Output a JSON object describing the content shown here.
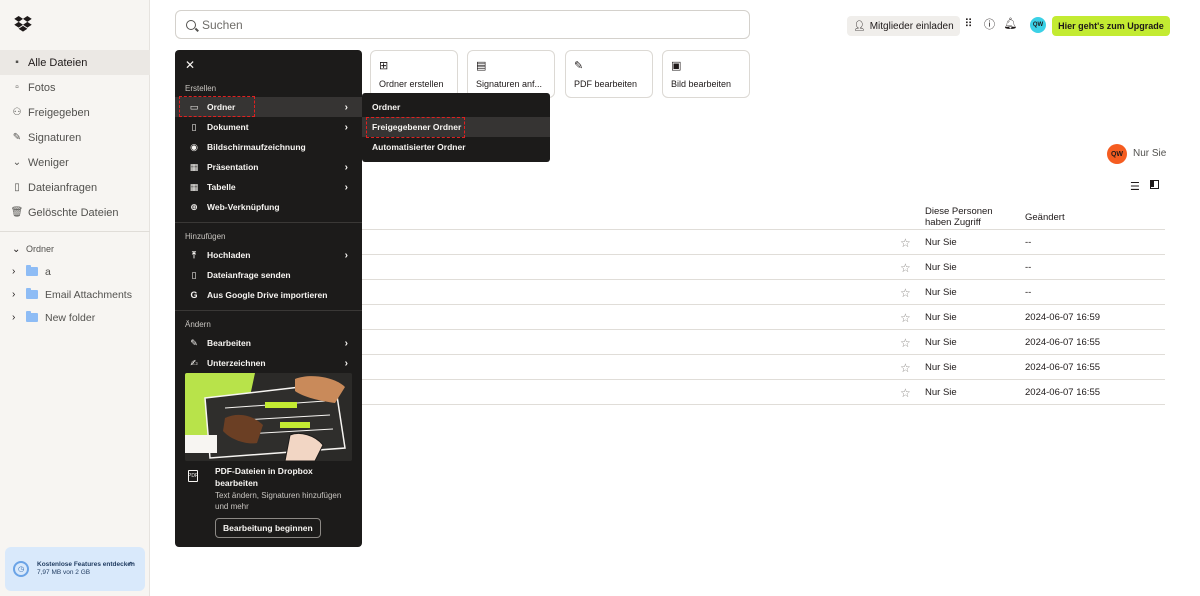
{
  "sidebar": {
    "nav": [
      {
        "label": "Alle Dateien",
        "icon": "files-icon",
        "active": true
      },
      {
        "label": "Fotos",
        "icon": "photo-icon"
      },
      {
        "label": "Freigegeben",
        "icon": "shared-icon"
      },
      {
        "label": "Signaturen",
        "icon": "signature-icon"
      },
      {
        "label": "Weniger",
        "icon": "chevron-down-icon"
      },
      {
        "label": "Dateianfragen",
        "icon": "file-request-icon"
      },
      {
        "label": "Gelöschte Dateien",
        "icon": "trash-icon"
      }
    ],
    "folders_heading": "Ordner",
    "folders": [
      "a",
      "Email Attachments",
      "New folder"
    ],
    "promo": {
      "title": "Kostenlose Features entdecken",
      "usage": "7,97 MB von 2 GB"
    }
  },
  "topbar": {
    "search_placeholder": "Suchen",
    "invite_label": "Mitglieder einladen",
    "avatar_initials": "QW",
    "upgrade_label": "Hier geht's zum Upgrade"
  },
  "quick_actions": [
    {
      "label": "Ordner erstellen",
      "icon": "folder-plus-icon"
    },
    {
      "label": "Signaturen anf...",
      "icon": "signature-request-icon"
    },
    {
      "label": "PDF bearbeiten",
      "icon": "pen-icon"
    },
    {
      "label": "Bild bearbeiten",
      "icon": "image-edit-icon"
    }
  ],
  "table": {
    "owner_initials": "QW",
    "owner_label": "Nur Sie",
    "col_access": "Diese Personen haben Zugriff",
    "col_changed": "Geändert",
    "rows": [
      {
        "access": "Nur Sie",
        "changed": "--"
      },
      {
        "access": "Nur Sie",
        "changed": "--"
      },
      {
        "access": "Nur Sie",
        "changed": "--"
      },
      {
        "access": "Nur Sie",
        "changed": "2024-06-07 16:59"
      },
      {
        "access": "Nur Sie",
        "changed": "2024-06-07 16:55"
      },
      {
        "access": "Nur Sie",
        "changed": "2024-06-07 16:55"
      },
      {
        "access": "Nur Sie",
        "changed": "2024-06-07 16:55"
      }
    ]
  },
  "menu": {
    "section_create": "Erstellen",
    "create_items": [
      "Ordner",
      "Dokument",
      "Bildschirmaufzeichnung",
      "Präsentation",
      "Tabelle",
      "Web-Verknüpfung"
    ],
    "section_add": "Hinzufügen",
    "add_items": [
      "Hochladen",
      "Dateianfrage senden",
      "Aus Google Drive importieren"
    ],
    "section_change": "Ändern",
    "change_items": [
      "Bearbeiten",
      "Unterzeichnen"
    ],
    "promo_title": "PDF-Dateien in Dropbox bearbeiten",
    "promo_desc": "Text ändern, Signaturen hinzufügen und mehr",
    "promo_button": "Bearbeitung beginnen"
  },
  "submenu": {
    "items": [
      "Ordner",
      "Freigegebener Ordner",
      "Automatisierter Ordner"
    ]
  },
  "colors": {
    "accent": "#c3eb32",
    "menu_bg": "#1c1b1a",
    "highlight_dash": "#e02020"
  }
}
